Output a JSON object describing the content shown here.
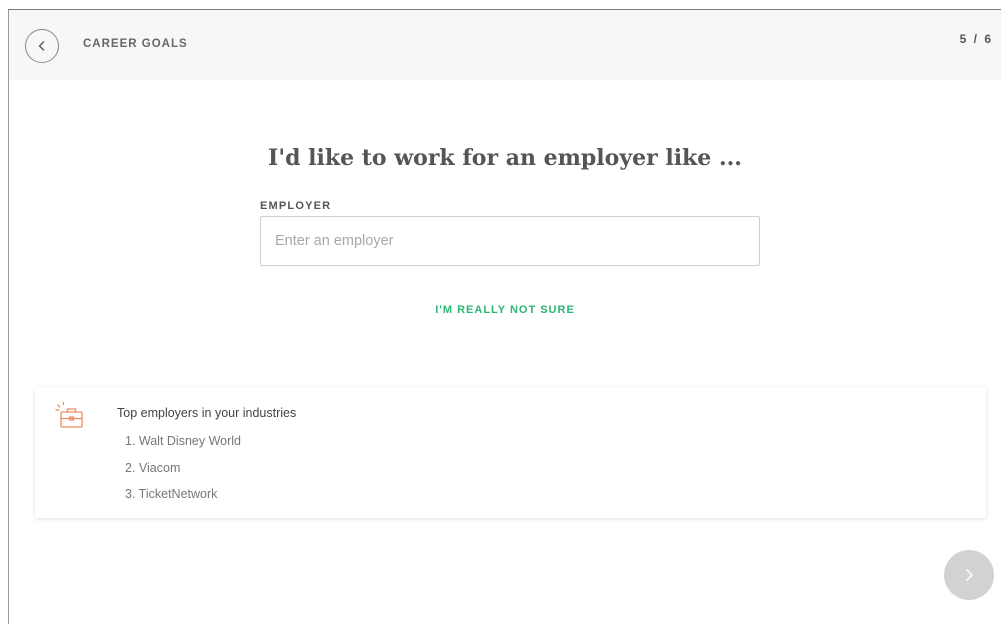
{
  "header": {
    "title": "CAREER GOALS",
    "step_indicator": "5 / 6"
  },
  "question": {
    "heading": "I'd like to work for an employer like ..."
  },
  "employer_field": {
    "label": "EMPLOYER",
    "value": "",
    "placeholder": "Enter an employer"
  },
  "not_sure_link": "I'M REALLY NOT SURE",
  "suggestions": {
    "title": "Top employers in your industries",
    "icon": "briefcase-icon",
    "items": [
      "1. Walt Disney World",
      "2. Viacom",
      "3. TicketNetwork"
    ]
  },
  "colors": {
    "accent_green": "#2bb673",
    "icon_orange": "#f28a60",
    "next_button": "#d2d2d2",
    "header_bg": "#f7f7f7"
  }
}
